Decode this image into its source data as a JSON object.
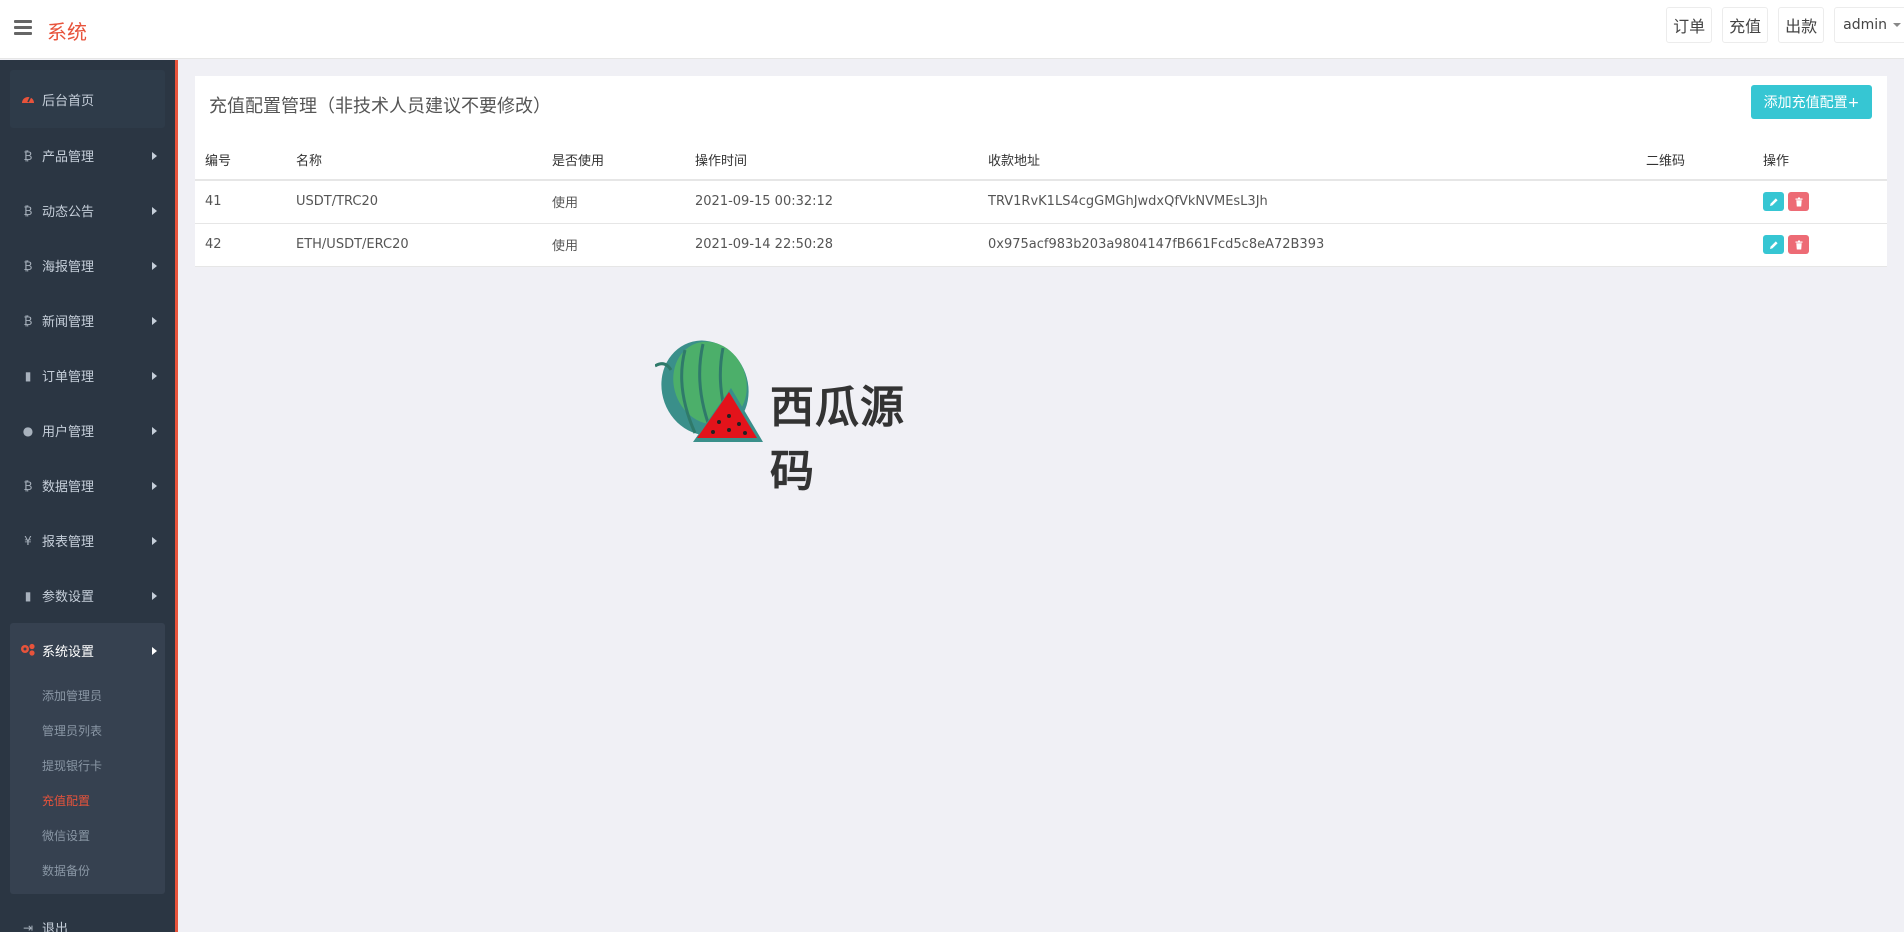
{
  "app": {
    "brand": "系统"
  },
  "top_actions": {
    "orders": "订单",
    "recharge": "充值",
    "withdraw": "出款",
    "user": "admin"
  },
  "sidebar": {
    "home": "后台首页",
    "items": [
      {
        "label": "产品管理",
        "icon": "bitcoin-icon"
      },
      {
        "label": "动态公告",
        "icon": "bitcoin-icon"
      },
      {
        "label": "海报管理",
        "icon": "bitcoin-icon"
      },
      {
        "label": "新闻管理",
        "icon": "bitcoin-icon"
      },
      {
        "label": "订单管理",
        "icon": "copy-icon"
      },
      {
        "label": "用户管理",
        "icon": "user-icon"
      },
      {
        "label": "数据管理",
        "icon": "bitcoin-icon"
      },
      {
        "label": "报表管理",
        "icon": "yen-icon"
      },
      {
        "label": "参数设置",
        "icon": "copy-icon"
      }
    ],
    "active_group": {
      "label": "系统设置",
      "icon": "cogs-icon",
      "subitems": [
        "添加管理员",
        "管理员列表",
        "提现银行卡",
        "充值配置",
        "微信设置",
        "数据备份"
      ],
      "current": "充值配置"
    },
    "logout": "退出"
  },
  "panel": {
    "title": "充值配置管理（非技术人员建议不要修改）",
    "add_button": "添加充值配置+",
    "columns": [
      "编号",
      "名称",
      "是否使用",
      "操作时间",
      "收款地址",
      "二维码",
      "操作"
    ],
    "rows": [
      {
        "id": "41",
        "name": "USDT/TRC20",
        "in_use": "使用",
        "time": "2021-09-15 00:32:12",
        "address": "TRV1RvK1LS4cgGMGhJwdxQfVkNVMEsL3Jh",
        "qrcode": ""
      },
      {
        "id": "42",
        "name": "ETH/USDT/ERC20",
        "in_use": "使用",
        "time": "2021-09-14 22:50:28",
        "address": "0x975acf983b203a9804147fB661Fcd5c8eA72B393",
        "qrcode": ""
      }
    ]
  },
  "watermark": {
    "text": "西瓜源码"
  },
  "colors": {
    "accent": "#e8533b",
    "sidebar_bg": "#2b3643",
    "teal": "#36c6d3",
    "danger": "#ed6b75"
  }
}
